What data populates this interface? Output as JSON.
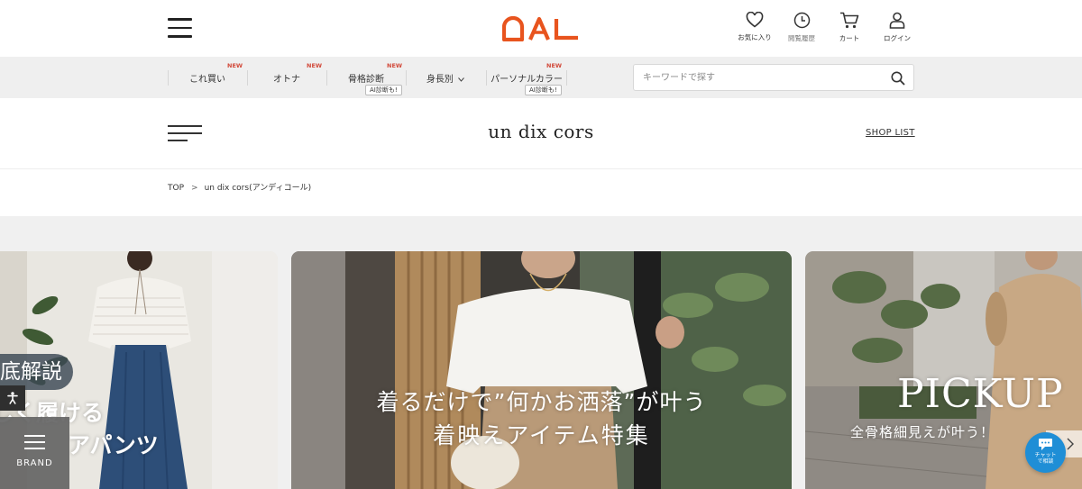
{
  "header": {
    "logo_text": "OAL",
    "logo_color": "#e8541e",
    "icons": [
      {
        "name": "heart-icon",
        "label": "お気に入り"
      },
      {
        "name": "clock-icon",
        "label": "閲覧履歴"
      },
      {
        "name": "cart-icon",
        "label": "カート"
      },
      {
        "name": "user-icon",
        "label": "ログイン"
      }
    ]
  },
  "nav": {
    "items": [
      {
        "label": "これ買い",
        "new": "NEW",
        "ai": ""
      },
      {
        "label": "オトナ",
        "new": "NEW",
        "ai": ""
      },
      {
        "label": "骨格診断",
        "new": "NEW",
        "ai": "AI診断も!"
      },
      {
        "label": "身長別",
        "new": "",
        "ai": ""
      },
      {
        "label": "パーソナルカラー",
        "new": "NEW",
        "ai": "AI診断も!"
      }
    ],
    "search_placeholder": "キーワードで探す"
  },
  "brand": {
    "name": "un dix cors",
    "shop_list": "SHOP LIST"
  },
  "breadcrumb": {
    "top": "TOP",
    "separator": ">",
    "current": "un dix cors(アンディコール)"
  },
  "slides": [
    {
      "pill": "底解説",
      "line1": "しく履ける",
      "line2": "アパンツ"
    },
    {
      "line1": "着るだけで”何かお洒落”が叶う",
      "line2": "着映えアイテム特集"
    },
    {
      "title": "PICKUP",
      "subtitle": "全骨格細見えが叶う！"
    }
  ],
  "widgets": {
    "brand_button": "BRAND",
    "chat_label": "チャット\nで相談"
  },
  "colors": {
    "accent": "#e8541e",
    "new_badge": "#d24a3a",
    "nav_bg": "#efefef",
    "chat": "#1f8ed6"
  }
}
